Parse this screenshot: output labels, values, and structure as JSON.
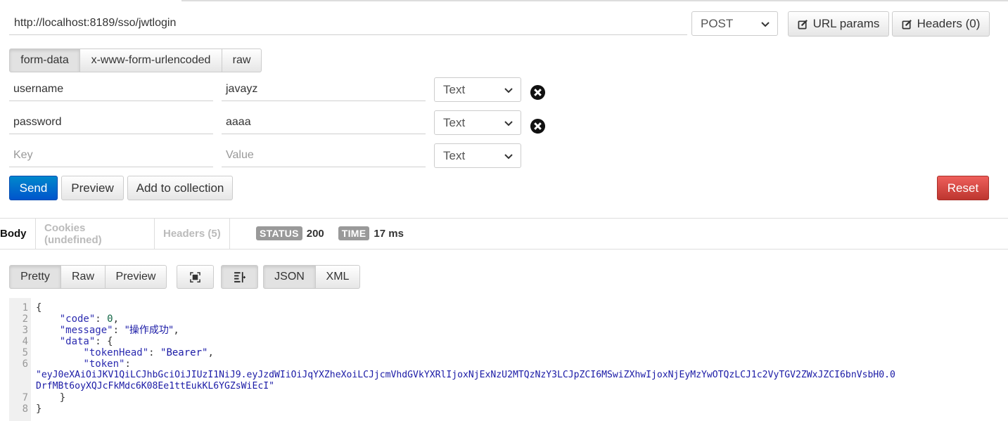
{
  "request": {
    "url": "http://localhost:8189/sso/jwtlogin",
    "method": "POST",
    "url_params_label": "URL params",
    "headers_label": "Headers (0)"
  },
  "body_tabs": [
    "form-data",
    "x-www-form-urlencoded",
    "raw"
  ],
  "form_rows": [
    {
      "key": "username",
      "value": "javayz",
      "type": "Text"
    },
    {
      "key": "password",
      "value": "aaaa",
      "type": "Text"
    }
  ],
  "new_row": {
    "key_placeholder": "Key",
    "value_placeholder": "Value",
    "type": "Text"
  },
  "actions": {
    "send": "Send",
    "preview": "Preview",
    "add_to_collection": "Add to collection",
    "reset": "Reset"
  },
  "response": {
    "tabs": [
      "Body",
      "Cookies (undefined)",
      "Headers (5)"
    ],
    "status_label": "STATUS",
    "status_value": "200",
    "time_label": "TIME",
    "time_value": "17 ms",
    "view_modes": [
      "Pretty",
      "Raw",
      "Preview"
    ],
    "formats": [
      "JSON",
      "XML"
    ],
    "icons": [
      "fullscreen-icon",
      "wrap-lines-icon"
    ]
  },
  "code": {
    "line_numbers": [
      "1",
      "2",
      "3",
      "4",
      "5",
      "6",
      "7",
      "8"
    ],
    "open_brace": "{",
    "code_key": "\"code\"",
    "code_value": "0",
    "message_key": "\"message\"",
    "message_value": "\"操作成功\"",
    "data_key": "\"data\"",
    "token_head_key": "\"tokenHead\"",
    "token_head_value": "\"Bearer\"",
    "token_key": "\"token\"",
    "token_line1": "\"eyJ0eXAiOiJKV1QiLCJhbGciOiJIUzI1NiJ9.eyJzdWIiOiJqYXZheXoiLCJjcmVhdGVkYXRlIjoxNjExNzU2MTQzNzY3LCJpZCI6MSwiZXhwIjoxNjEyMzYwOTQzLCJ1c2VyTGV2ZWxJZCI6bnVsbH0.0",
    "token_line2": "DrfMBt6oyXQJcFkMdc6K08Ee1ttEukKL6YGZsWiEcI\"",
    "close_inner": "}",
    "close_outer": "}"
  }
}
